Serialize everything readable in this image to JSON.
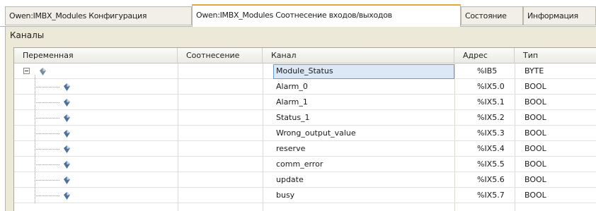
{
  "tabs": [
    {
      "label": "Owen:IMBX_Modules Конфигурация",
      "active": false
    },
    {
      "label": "Owen:IMBX_Modules Соотнесение входов/выходов",
      "active": true
    },
    {
      "label": "Состояние",
      "active": false
    },
    {
      "label": "Информация",
      "active": false
    }
  ],
  "panel": {
    "title": "Каналы"
  },
  "columns": {
    "variable": "Переменная",
    "mapping": "Соотнесение",
    "channel": "Канал",
    "address": "Адрес",
    "type": "Тип"
  },
  "rows": [
    {
      "variable": "",
      "mapping": "",
      "channel": "Module_Status",
      "address": "%IB5",
      "type": "BYTE",
      "selected": true,
      "icon": "module-variable-icon"
    },
    {
      "variable": "",
      "mapping": "",
      "channel": "Alarm_0",
      "address": "%IX5.0",
      "type": "BOOL",
      "icon": "variable-icon"
    },
    {
      "variable": "",
      "mapping": "",
      "channel": "Alarm_1",
      "address": "%IX5.1",
      "type": "BOOL",
      "icon": "variable-icon"
    },
    {
      "variable": "",
      "mapping": "",
      "channel": "Status_1",
      "address": "%IX5.2",
      "type": "BOOL",
      "icon": "variable-icon"
    },
    {
      "variable": "",
      "mapping": "",
      "channel": "Wrong_output_value",
      "address": "%IX5.3",
      "type": "BOOL",
      "icon": "variable-icon"
    },
    {
      "variable": "",
      "mapping": "",
      "channel": "reserve",
      "address": "%IX5.4",
      "type": "BOOL",
      "icon": "variable-icon"
    },
    {
      "variable": "",
      "mapping": "",
      "channel": "comm_error",
      "address": "%IX5.5",
      "type": "BOOL",
      "icon": "variable-icon"
    },
    {
      "variable": "",
      "mapping": "",
      "channel": "update",
      "address": "%IX5.6",
      "type": "BOOL",
      "icon": "variable-icon"
    },
    {
      "variable": "",
      "mapping": "",
      "channel": "busy",
      "address": "%IX5.7",
      "type": "BOOL",
      "icon": "variable-icon"
    }
  ],
  "colors": {
    "active_tab_accent": "#e7a53a",
    "selection_fill": "#dde8f6",
    "selection_border": "#6f96c9",
    "panel_background": "#ece9d8"
  }
}
